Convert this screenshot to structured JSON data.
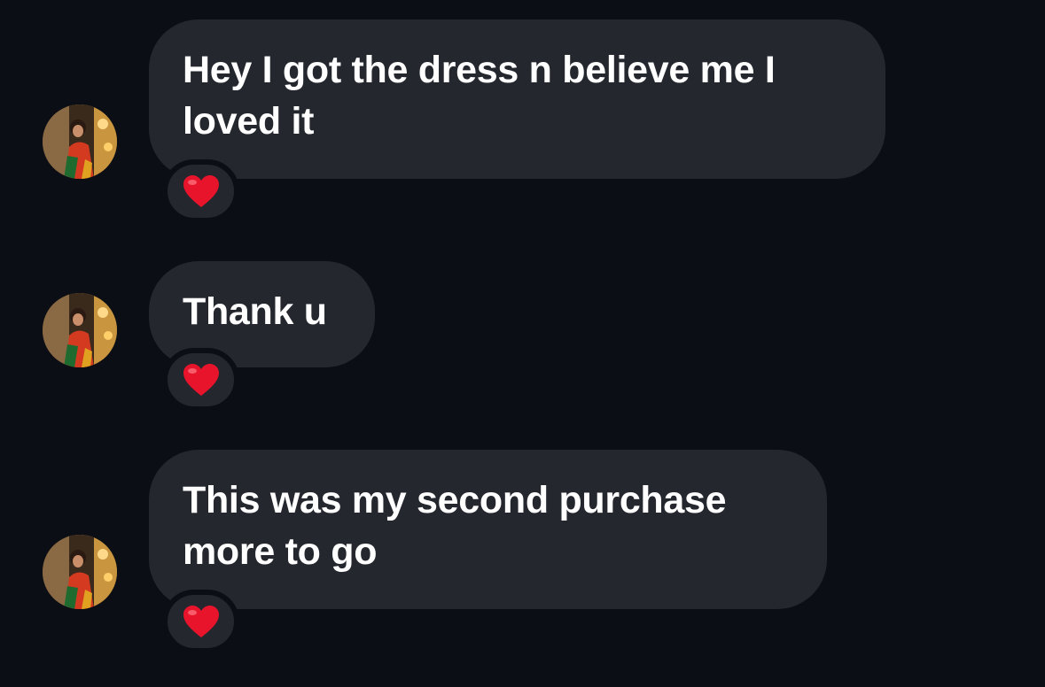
{
  "thread": {
    "messages": [
      {
        "text": "Hey I got the dress n believe me I loved it",
        "reaction": "heart-reaction"
      },
      {
        "text": "Thank u",
        "reaction": "heart-reaction"
      },
      {
        "text": "This was my second purchase more to go",
        "reaction": "heart-reaction"
      }
    ]
  },
  "colors": {
    "background": "#0b0e14",
    "bubble": "#24272e",
    "text": "#ffffff",
    "heart": "#e8142b"
  }
}
